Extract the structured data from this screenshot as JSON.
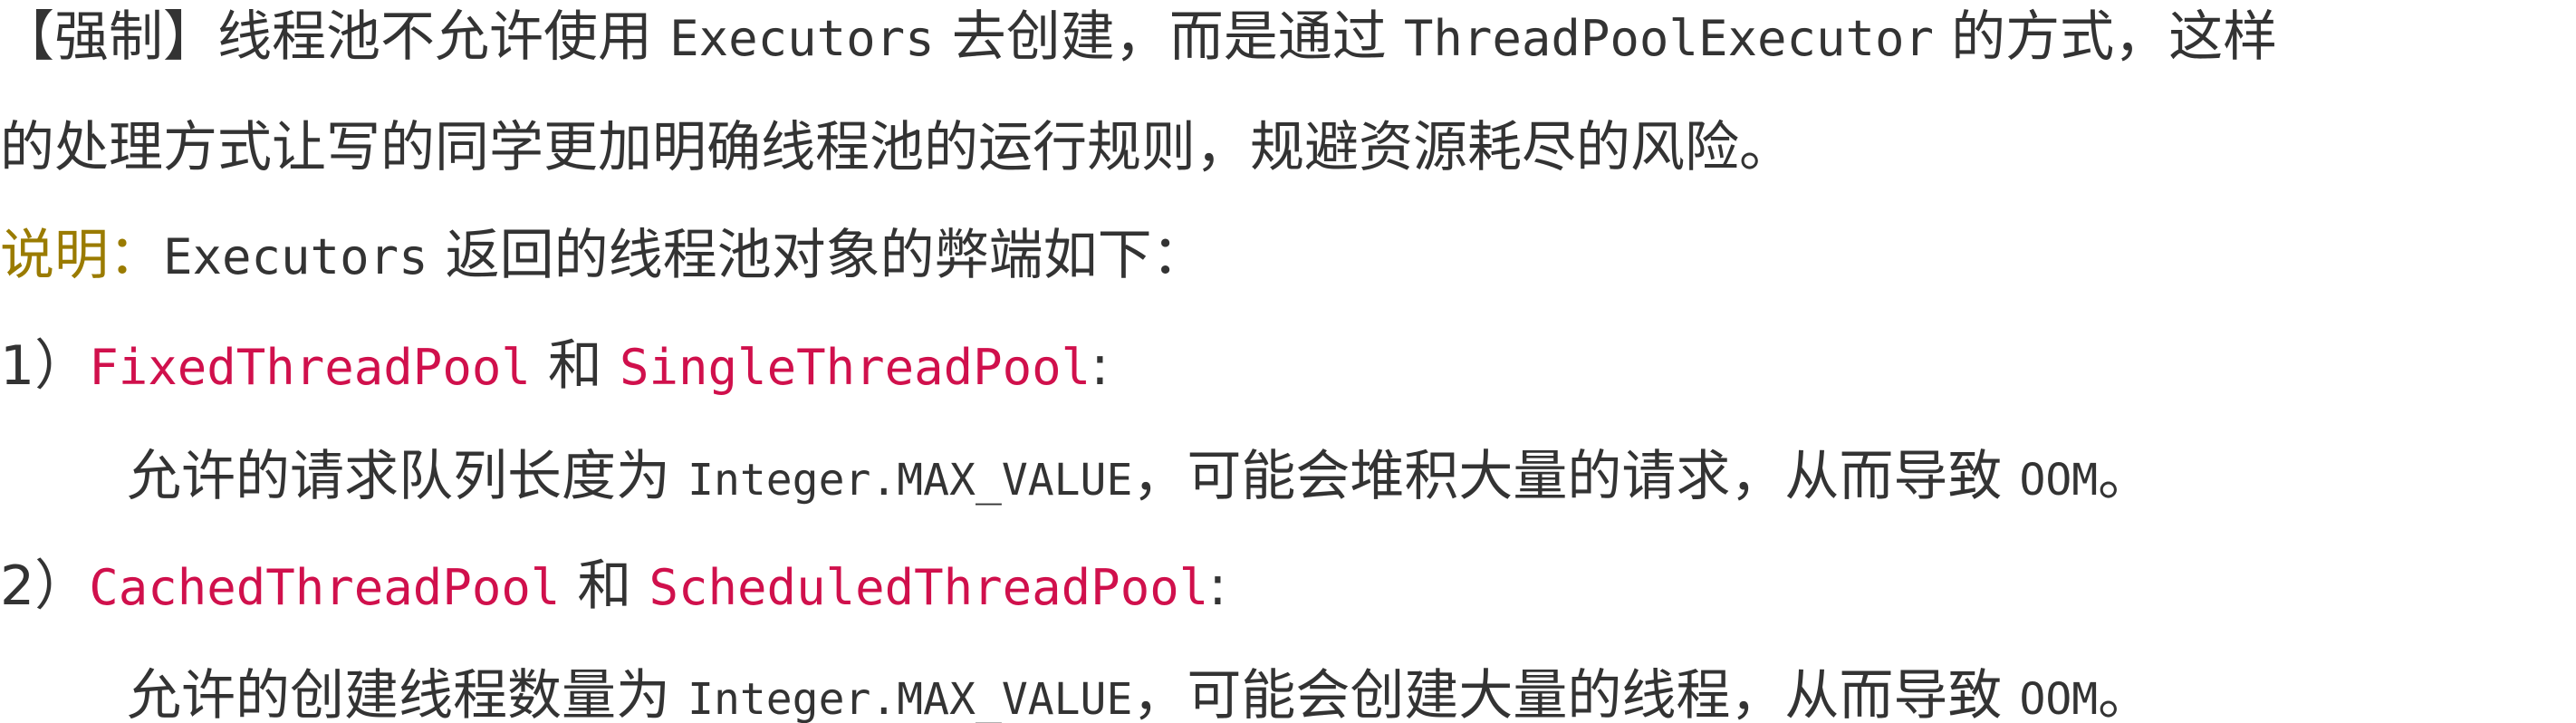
{
  "doc": {
    "line1": {
      "a": "【强制】线程池不允许使用 ",
      "b": "Executors",
      "c": " 去创建，而是通过 ",
      "d": "ThreadPoolExecutor",
      "e": " 的方式，这样"
    },
    "line2": "的处理方式让写的同学更加明确线程池的运行规则，规避资源耗尽的风险。",
    "line3": {
      "label": "说明：",
      "code": "Executors",
      "rest": " 返回的线程池对象的弊端如下："
    },
    "item1": {
      "num": "1）",
      "name1": "FixedThreadPool",
      "and": " 和 ",
      "name2": "SingleThreadPool",
      "colon": ":",
      "desc_a": "允许的请求队列长度为 ",
      "desc_code": "Integer.MAX_VALUE",
      "desc_b": "，可能会堆积大量的请求，从而导致 ",
      "desc_oom": "OOM",
      "desc_end": "。"
    },
    "item2": {
      "num": "2）",
      "name1": "CachedThreadPool",
      "and": " 和 ",
      "name2": "ScheduledThreadPool",
      "colon": ":",
      "desc_a": "允许的创建线程数量为 ",
      "desc_code": "Integer.MAX_VALUE",
      "desc_b": "，可能会创建大量的线程，从而导致 ",
      "desc_oom": "OOM",
      "desc_end": "。"
    }
  }
}
